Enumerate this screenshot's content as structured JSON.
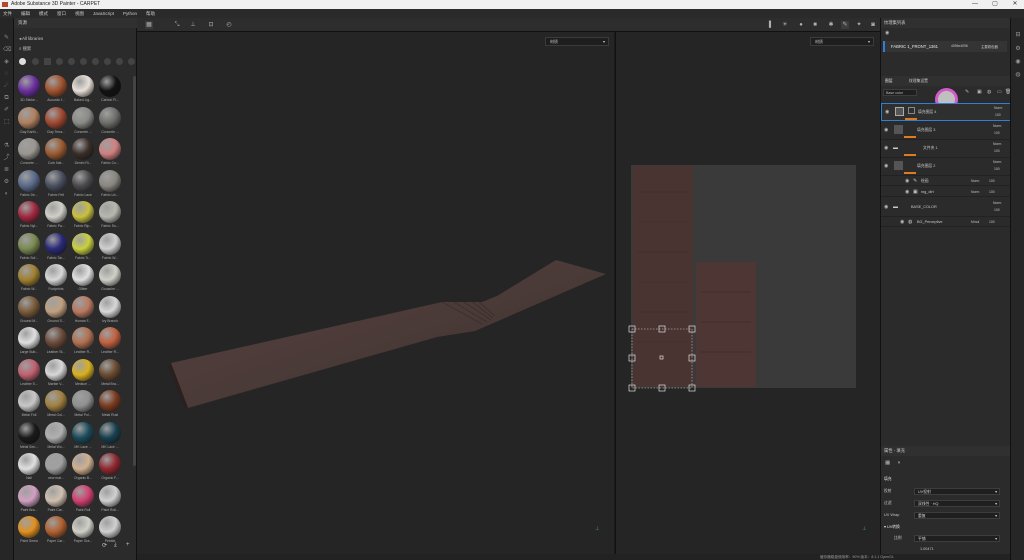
{
  "titlebar": {
    "title": "Adobe Substance 3D Painter - CARPET",
    "min": "—",
    "max": "▢",
    "close": "✕"
  },
  "menu": [
    "文件",
    "编辑",
    "模式",
    "窗口",
    "视图",
    "JavaScript",
    "Python",
    "帮助"
  ],
  "shelf": {
    "header": "资源",
    "path": "All libraries",
    "search_placeholder": "搜索",
    "materials": [
      {
        "label": "3D Sticke...",
        "color": "#6b2fa0"
      },
      {
        "label": "Acoustic f...",
        "color": "#a0522d"
      },
      {
        "label": "Baked Lig...",
        "color": "#e8e0d8"
      },
      {
        "label": "Carbon Fi...",
        "color": "#121212"
      },
      {
        "label": "Clay Earth...",
        "color": "#b08060"
      },
      {
        "label": "Clay Terra...",
        "color": "#a04830"
      },
      {
        "label": "Concrete ...",
        "color": "#8a8a86"
      },
      {
        "label": "Concrete ...",
        "color": "#6e6e6a"
      },
      {
        "label": "Concrete ...",
        "color": "#9a9690"
      },
      {
        "label": "Cork Nat...",
        "color": "#9a5a30"
      },
      {
        "label": "Denim Ri...",
        "color": "#3a2e28"
      },
      {
        "label": "Fabric Co...",
        "color": "#d08080"
      },
      {
        "label": "Fabric De...",
        "color": "#5a6a8a"
      },
      {
        "label": "Fabric Felt",
        "color": "#4a5060"
      },
      {
        "label": "Fabric Lace",
        "color": "#4a4a4e"
      },
      {
        "label": "Fabric Lin...",
        "color": "#8a8680"
      },
      {
        "label": "Fabric Nyl...",
        "color": "#a02840"
      },
      {
        "label": "Fabric Pa...",
        "color": "#d0d0c8"
      },
      {
        "label": "Fabric Rip...",
        "color": "#c8c040"
      },
      {
        "label": "Fabric So...",
        "color": "#b8b8b0"
      },
      {
        "label": "Fabric Sof...",
        "color": "#7a8a50"
      },
      {
        "label": "Fabric Tar...",
        "color": "#2a2a7a"
      },
      {
        "label": "Fabric Tr...",
        "color": "#c8d040"
      },
      {
        "label": "Fabric W...",
        "color": "#d0d0d0"
      },
      {
        "label": "Fabric W...",
        "color": "#a08030"
      },
      {
        "label": "Footprints",
        "color": "#d8d8d8"
      },
      {
        "label": "Glitter",
        "color": "#e0e0e0"
      },
      {
        "label": "Gouache ...",
        "color": "#d0d0c8"
      },
      {
        "label": "Ground M...",
        "color": "#7a5a3a"
      },
      {
        "label": "Ground S...",
        "color": "#c0a080"
      },
      {
        "label": "Human F...",
        "color": "#b87860"
      },
      {
        "label": "Ivy Branch",
        "color": "#d8d8d8"
      },
      {
        "label": "Large Bub...",
        "color": "#e0e0e0"
      },
      {
        "label": "Leather St...",
        "color": "#6a4a3a"
      },
      {
        "label": "Leather R...",
        "color": "#b07050"
      },
      {
        "label": "Leather R...",
        "color": "#c06040"
      },
      {
        "label": "Leather S...",
        "color": "#c06070"
      },
      {
        "label": "Marble V...",
        "color": "#d8d8d8"
      },
      {
        "label": "Medium ...",
        "color": "#d8b020"
      },
      {
        "label": "Metal Bra...",
        "color": "#6a4a30"
      },
      {
        "label": "Metal Foil",
        "color": "#c8c8c8"
      },
      {
        "label": "Metal Gol...",
        "color": "#a08040"
      },
      {
        "label": "Metal Pol...",
        "color": "#909090"
      },
      {
        "label": "Metal Rust",
        "color": "#7a3a20"
      },
      {
        "label": "Metal Sen...",
        "color": "#1a1a1a"
      },
      {
        "label": "Metal Wo...",
        "color": "#b0b0b0"
      },
      {
        "label": "MK Lace ...",
        "color": "#1a4a5a"
      },
      {
        "label": "MK Lace ...",
        "color": "#184050"
      },
      {
        "label": "Nail",
        "color": "#e0e0e0"
      },
      {
        "label": "new mat...",
        "color": "#a0a0a0"
      },
      {
        "label": "Organic B...",
        "color": "#d0b090"
      },
      {
        "label": "Organic F...",
        "color": "#902830"
      },
      {
        "label": "Paint Bra...",
        "color": "#d0a0c0"
      },
      {
        "label": "Paint Car...",
        "color": "#d0c0b0"
      },
      {
        "label": "Paint Roll",
        "color": "#d04070"
      },
      {
        "label": "Paint Roll...",
        "color": "#d0d0d0"
      },
      {
        "label": "Paint Smea",
        "color": "#e09020"
      },
      {
        "label": "Paper Car...",
        "color": "#b06030"
      },
      {
        "label": "Paper Gra...",
        "color": "#d0d0c8"
      },
      {
        "label": "Pebble",
        "color": "#d0d0d0"
      }
    ]
  },
  "viewport": {
    "left_mode": "材质",
    "right_mode": "材质"
  },
  "status": {
    "left": "",
    "right": "缓存器磁盘使用率：90%   版本：8.1.1   OpenGL"
  },
  "texture_set_list": {
    "header": "纹理集列表",
    "item": "FABRIC 1_FRONT_1361",
    "res": "4096x4096",
    "shader": "主要着色器"
  },
  "layers": {
    "tabs": [
      "图层",
      "纹理集设置"
    ],
    "channel": "Base color",
    "items": [
      {
        "name": "填充图层 4",
        "blend": "Norm",
        "opacity": "100"
      },
      {
        "name": "填充图层 3",
        "blend": "Norm",
        "opacity": "100"
      },
      {
        "name": "文件夹 1",
        "blend": "Norm",
        "opacity": "100"
      },
      {
        "name": "填充图层 2",
        "blend": "Norm",
        "opacity": "100"
      },
      {
        "name": "绘画",
        "blend": "Norm",
        "opacity": "100"
      },
      {
        "name": "mg_dirt",
        "blend": "Norm",
        "opacity": "100"
      },
      {
        "name": "BASE_COLOR",
        "blend": "Norm",
        "opacity": "100"
      },
      {
        "name": "BG_Perceptive",
        "blend": "Mmul",
        "opacity": "100"
      }
    ]
  },
  "properties": {
    "header": "属性 - 填充",
    "section": "填充",
    "rows": [
      {
        "label": "投射",
        "value": "UV投射"
      },
      {
        "label": "过滤",
        "value": "双线性 · HQ"
      },
      {
        "label": "UV Wrap",
        "value": "重复"
      }
    ],
    "uv_section": "UV转换",
    "scale_label": "比例",
    "scale_value": "平铺",
    "value_row": "1.00471"
  }
}
